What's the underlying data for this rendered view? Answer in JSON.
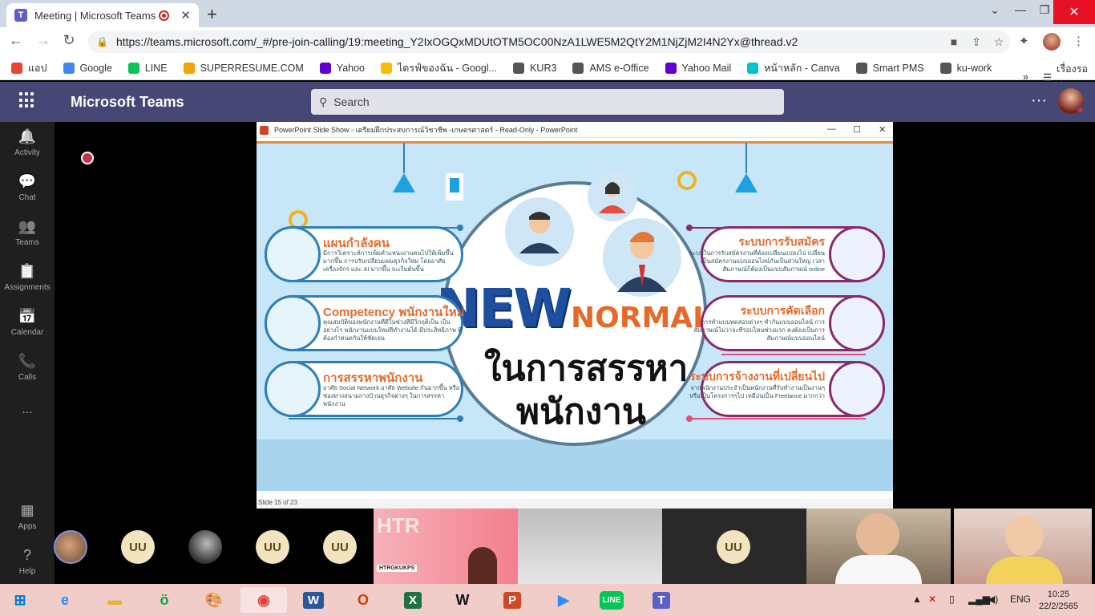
{
  "browser": {
    "tab_title": "Meeting | Microsoft Teams",
    "new_tab": "+",
    "url": "https://teams.microsoft.com/_#/pre-join-calling/19:meeting_Y2IxOGQxMDUtOTM5OC00NzA1LWE5M2QtY2M1NjZjM2I4N2Yx@thread.v2",
    "bookmarks": [
      {
        "label": "แอป",
        "color": "#ea4335"
      },
      {
        "label": "Google",
        "color": "#4285f4"
      },
      {
        "label": "LINE",
        "color": "#06c755"
      },
      {
        "label": "SUPERRESUME.COM",
        "color": "#f4a300"
      },
      {
        "label": "Yahoo",
        "color": "#6001d2"
      },
      {
        "label": "ไดรฟ์ของฉัน - Googl...",
        "color": "#fbbc04"
      },
      {
        "label": "KUR3",
        "color": "#555555"
      },
      {
        "label": "AMS e-Office",
        "color": "#555555"
      },
      {
        "label": "Yahoo Mail",
        "color": "#6001d2"
      },
      {
        "label": "หน้าหลัก - Canva",
        "color": "#00c4cc"
      },
      {
        "label": "Smart PMS",
        "color": "#555555"
      },
      {
        "label": "ku-work",
        "color": "#555555"
      }
    ],
    "bookmarks_more": "»",
    "reading_list": "เรื่องรออ่าน"
  },
  "teams": {
    "app_title": "Microsoft Teams",
    "search_placeholder": "Search",
    "more": "···",
    "rail": [
      {
        "label": "Activity",
        "icon": "bell-icon",
        "glyph": "🔔"
      },
      {
        "label": "Chat",
        "icon": "chat-icon",
        "glyph": "💬"
      },
      {
        "label": "Teams",
        "icon": "teams-icon",
        "glyph": "👥"
      },
      {
        "label": "Assignments",
        "icon": "assignments-icon",
        "glyph": "📋"
      },
      {
        "label": "Calendar",
        "icon": "calendar-icon",
        "glyph": "📅"
      },
      {
        "label": "Calls",
        "icon": "calls-icon",
        "glyph": "📞"
      },
      {
        "label": "...",
        "icon": "more-icon",
        "glyph": ""
      }
    ],
    "rail_bottom": [
      {
        "label": "Apps",
        "icon": "apps-icon",
        "glyph": "▦"
      },
      {
        "label": "Help",
        "icon": "help-icon",
        "glyph": "?"
      }
    ]
  },
  "powerpoint": {
    "window_title": "PowerPoint Slide Show  -  เตรียมฝึกประสบการณ์วิชาชีพ -เกษตรศาสตร์  -  Read-Only - PowerPoint",
    "status": "Slide 15 of 23"
  },
  "slide": {
    "new": "NEW",
    "normal": "NORMAL",
    "thai_line1": "ในการสรรหา",
    "thai_line2": "พนักงาน",
    "left_cards": [
      {
        "heading": "แผนกำลังคน",
        "text": "มีการวิเคราะห์การเพิ่มตำแหน่งงานคนไปให้เพิ่มขึ้นมากขึ้น การปรับเปลี่ยนแผนธุรกิจใหม่ โดยอาศัยเครื่องจักร และ AI มากขึ้น จะเริ่มต้นขึ้น"
      },
      {
        "heading": "Competency พนักงานใหม่",
        "text": "คุณสมบัติของพนักงานที่ดีในช่วงที่มีวิกฤติเป็น เป็นอย่างไร พนักงานแบบใหม่ที่ทำงานได้ มีประสิทธิภาพ ที่ต้องกำหนดกันให้ชัดเจน"
      },
      {
        "heading": "การสรรหาพนักงาน",
        "text": "อาศัย Social Network อาศัย Website กันมากขึ้น หรือช่องทางสนามกางบ้านธุรกิจต่างๆ ในการสรรหาพนักงาน"
      }
    ],
    "right_cards": [
      {
        "heading": "ระบบการรับสมัคร",
        "text": "ระบบในการรับสมัครงานที่ต้องเปลี่ยนแปลงไป เปลี่ยนเป็นสมัครงานแบบออนไลน์กันเป็นส่วนใหญ่ เวลาสัมภาษณ์ก็ต้องเป็นแบบสัมภาษณ์ online"
      },
      {
        "heading": "ระบบการคัดเลือก",
        "text": "การทำแบบทดสอบต่างๆ ทำกันแบบออนไลน์ การสัมภาษณ์ไม่ว่าจะที่รอบไหนช่วงแรก คงต้องเป็นการสัมภาษณ์แบบออนไลน์"
      },
      {
        "heading": "ระบบการจ้างงานที่เปลี่ยนไป",
        "text": "จากพนักงานประจำเป็นพนักงานที่รับทำงานเป็นงานๆ หรือเป็นโครงการๆไป เหมือนเป็น Freelance มากกว่า"
      }
    ]
  },
  "gallery": {
    "initials": "UU",
    "share_title": "HTR",
    "share_sub": "HTRGKUKPS"
  },
  "taskbar": {
    "apps": [
      {
        "name": "start",
        "glyph": "⊞",
        "color": "#0078d7"
      },
      {
        "name": "ie",
        "glyph": "e",
        "color": "#1e90ff"
      },
      {
        "name": "explorer",
        "glyph": "▬",
        "color": "#e6b33b"
      },
      {
        "name": "line-green",
        "glyph": "ö",
        "color": "#10a44a"
      },
      {
        "name": "paint",
        "glyph": "🎨",
        "color": "#888888"
      },
      {
        "name": "chrome",
        "glyph": "◉",
        "color": "#db4437"
      },
      {
        "name": "word",
        "glyph": "W",
        "color": "#2b579a"
      },
      {
        "name": "office",
        "glyph": "O",
        "color": "#d83b01"
      },
      {
        "name": "excel",
        "glyph": "X",
        "color": "#217346"
      },
      {
        "name": "webex",
        "glyph": "W",
        "color": "#111111"
      },
      {
        "name": "powerpoint",
        "glyph": "P",
        "color": "#d24726"
      },
      {
        "name": "zoom",
        "glyph": "▶",
        "color": "#2d8cff"
      },
      {
        "name": "line",
        "glyph": "LINE",
        "color": "#06c755"
      },
      {
        "name": "teams",
        "glyph": "T",
        "color": "#5b5fc7"
      }
    ],
    "lang": "ENG",
    "time": "10:25",
    "date": "22/2/2565"
  }
}
